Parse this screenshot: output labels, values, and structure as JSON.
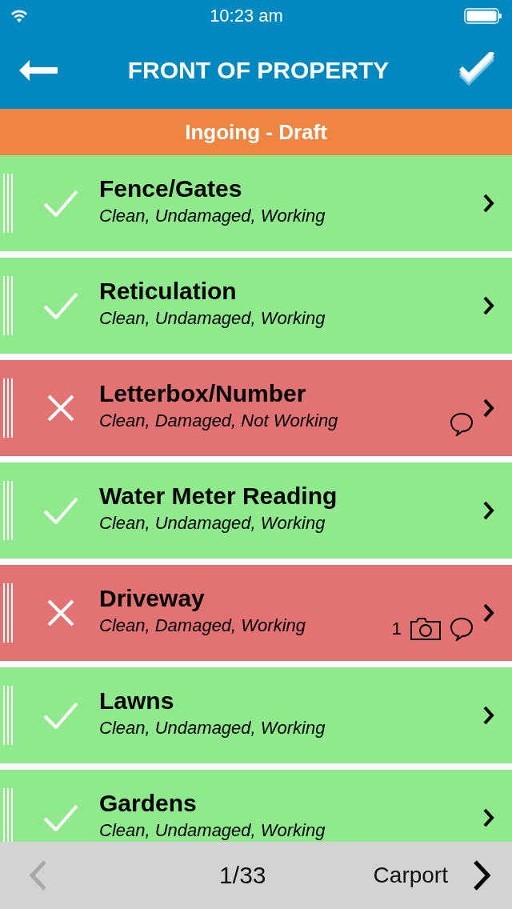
{
  "status_bar": {
    "time": "10:23 am"
  },
  "nav": {
    "title": "FRONT OF PROPERTY"
  },
  "banner": "Ingoing - Draft",
  "items": [
    {
      "title": "Fence/Gates",
      "detail": "Clean, Undamaged, Working",
      "kind": "pass",
      "comment": false
    },
    {
      "title": "Reticulation",
      "detail": "Clean, Undamaged, Working",
      "kind": "pass",
      "comment": false
    },
    {
      "title": "Letterbox/Number",
      "detail": "Clean, Damaged, Not Working",
      "kind": "fail",
      "comment": true
    },
    {
      "title": "Water Meter Reading",
      "detail": "Clean, Undamaged, Working",
      "kind": "pass",
      "comment": false
    },
    {
      "title": "Driveway",
      "detail": "Clean, Damaged, Working",
      "kind": "fail",
      "comment": true,
      "photos": "1"
    },
    {
      "title": "Lawns",
      "detail": "Clean, Undamaged, Working",
      "kind": "pass",
      "comment": false
    },
    {
      "title": "Gardens",
      "detail": "Clean, Undamaged, Working",
      "kind": "pass",
      "comment": false
    }
  ],
  "footer": {
    "prev_disabled": true,
    "page": "1/33",
    "next_label": "Carport"
  }
}
